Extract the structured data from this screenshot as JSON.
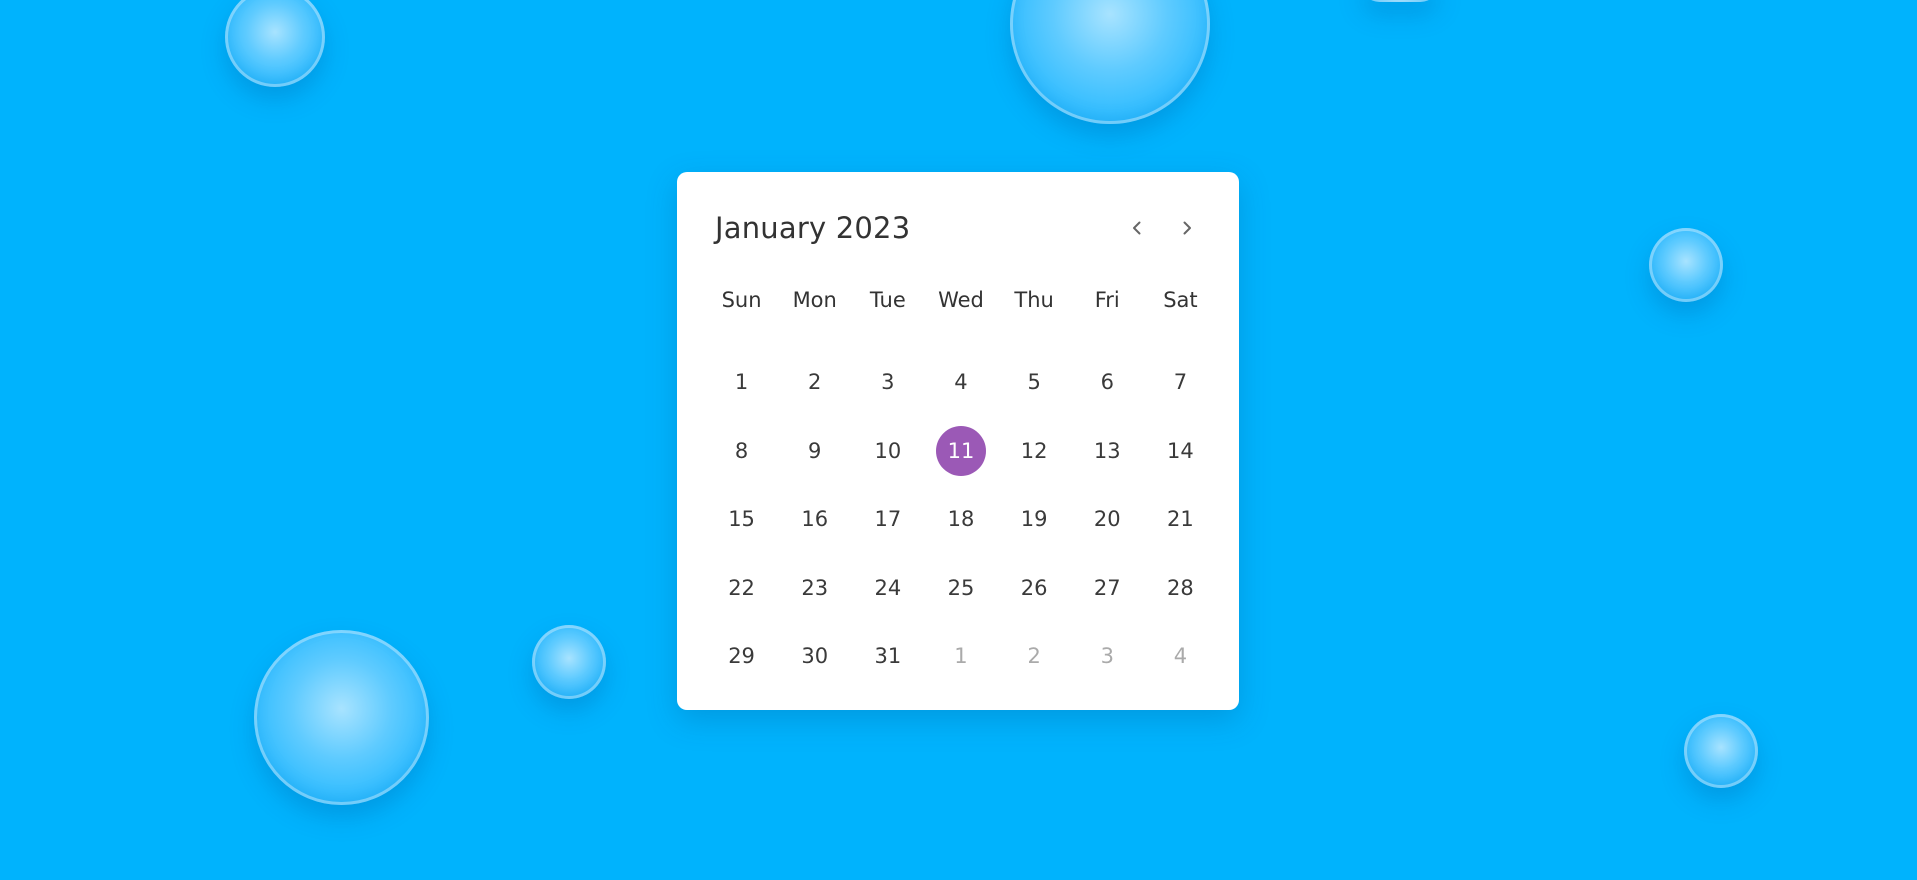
{
  "colors": {
    "background": "#00b3fd",
    "card": "#ffffff",
    "text": "#333333",
    "muted_text": "#aaaaaa",
    "selected": "#9b59b6",
    "selected_text": "#ffffff"
  },
  "calendar": {
    "month_title": "January 2023",
    "prev_icon": "chevron-left-icon",
    "next_icon": "chevron-right-icon",
    "weekdays": [
      "Sun",
      "Mon",
      "Tue",
      "Wed",
      "Thu",
      "Fri",
      "Sat"
    ],
    "weeks": [
      [
        {
          "label": "1"
        },
        {
          "label": "2"
        },
        {
          "label": "3"
        },
        {
          "label": "4"
        },
        {
          "label": "5"
        },
        {
          "label": "6"
        },
        {
          "label": "7"
        }
      ],
      [
        {
          "label": "8"
        },
        {
          "label": "9"
        },
        {
          "label": "10"
        },
        {
          "label": "11",
          "selected": true
        },
        {
          "label": "12"
        },
        {
          "label": "13"
        },
        {
          "label": "14"
        }
      ],
      [
        {
          "label": "15"
        },
        {
          "label": "16"
        },
        {
          "label": "17"
        },
        {
          "label": "18"
        },
        {
          "label": "19"
        },
        {
          "label": "20"
        },
        {
          "label": "21"
        }
      ],
      [
        {
          "label": "22"
        },
        {
          "label": "23"
        },
        {
          "label": "24"
        },
        {
          "label": "25"
        },
        {
          "label": "26"
        },
        {
          "label": "27"
        },
        {
          "label": "28"
        }
      ],
      [
        {
          "label": "29"
        },
        {
          "label": "30"
        },
        {
          "label": "31"
        },
        {
          "label": "1",
          "other_month": true
        },
        {
          "label": "2",
          "other_month": true
        },
        {
          "label": "3",
          "other_month": true
        },
        {
          "label": "4",
          "other_month": true
        }
      ]
    ]
  }
}
